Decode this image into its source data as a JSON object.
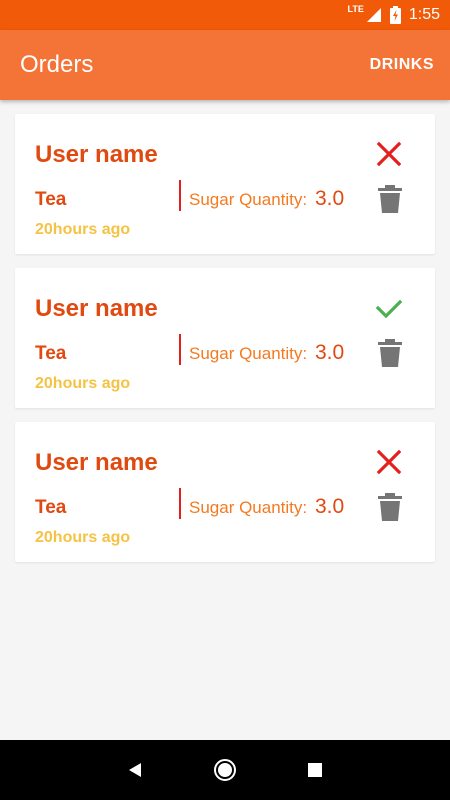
{
  "status_bar": {
    "network": "LTE",
    "time": "1:55"
  },
  "app_bar": {
    "title": "Orders",
    "action_label": "DRINKS"
  },
  "orders": [
    {
      "user_name": "User name",
      "drink": "Tea",
      "sugar_label": "Sugar Quantity:",
      "sugar_value": "3.0",
      "time_ago": "20hours ago",
      "status": "declined"
    },
    {
      "user_name": "User name",
      "drink": "Tea",
      "sugar_label": "Sugar Quantity:",
      "sugar_value": "3.0",
      "time_ago": "20hours ago",
      "status": "accepted"
    },
    {
      "user_name": "User name",
      "drink": "Tea",
      "sugar_label": "Sugar Quantity:",
      "sugar_value": "3.0",
      "time_ago": "20hours ago",
      "status": "declined"
    }
  ],
  "colors": {
    "status_bar": "#f15a08",
    "app_bar": "#f47336",
    "accent_text": "#e04a10",
    "time_text": "#f6c244",
    "declined": "#e4201e",
    "accepted": "#4caf50",
    "delete_icon": "#757575"
  },
  "icons": {
    "declined": "close-icon",
    "accepted": "check-icon",
    "delete": "trash-icon",
    "nav": [
      "back-icon",
      "home-icon",
      "recents-icon"
    ]
  }
}
